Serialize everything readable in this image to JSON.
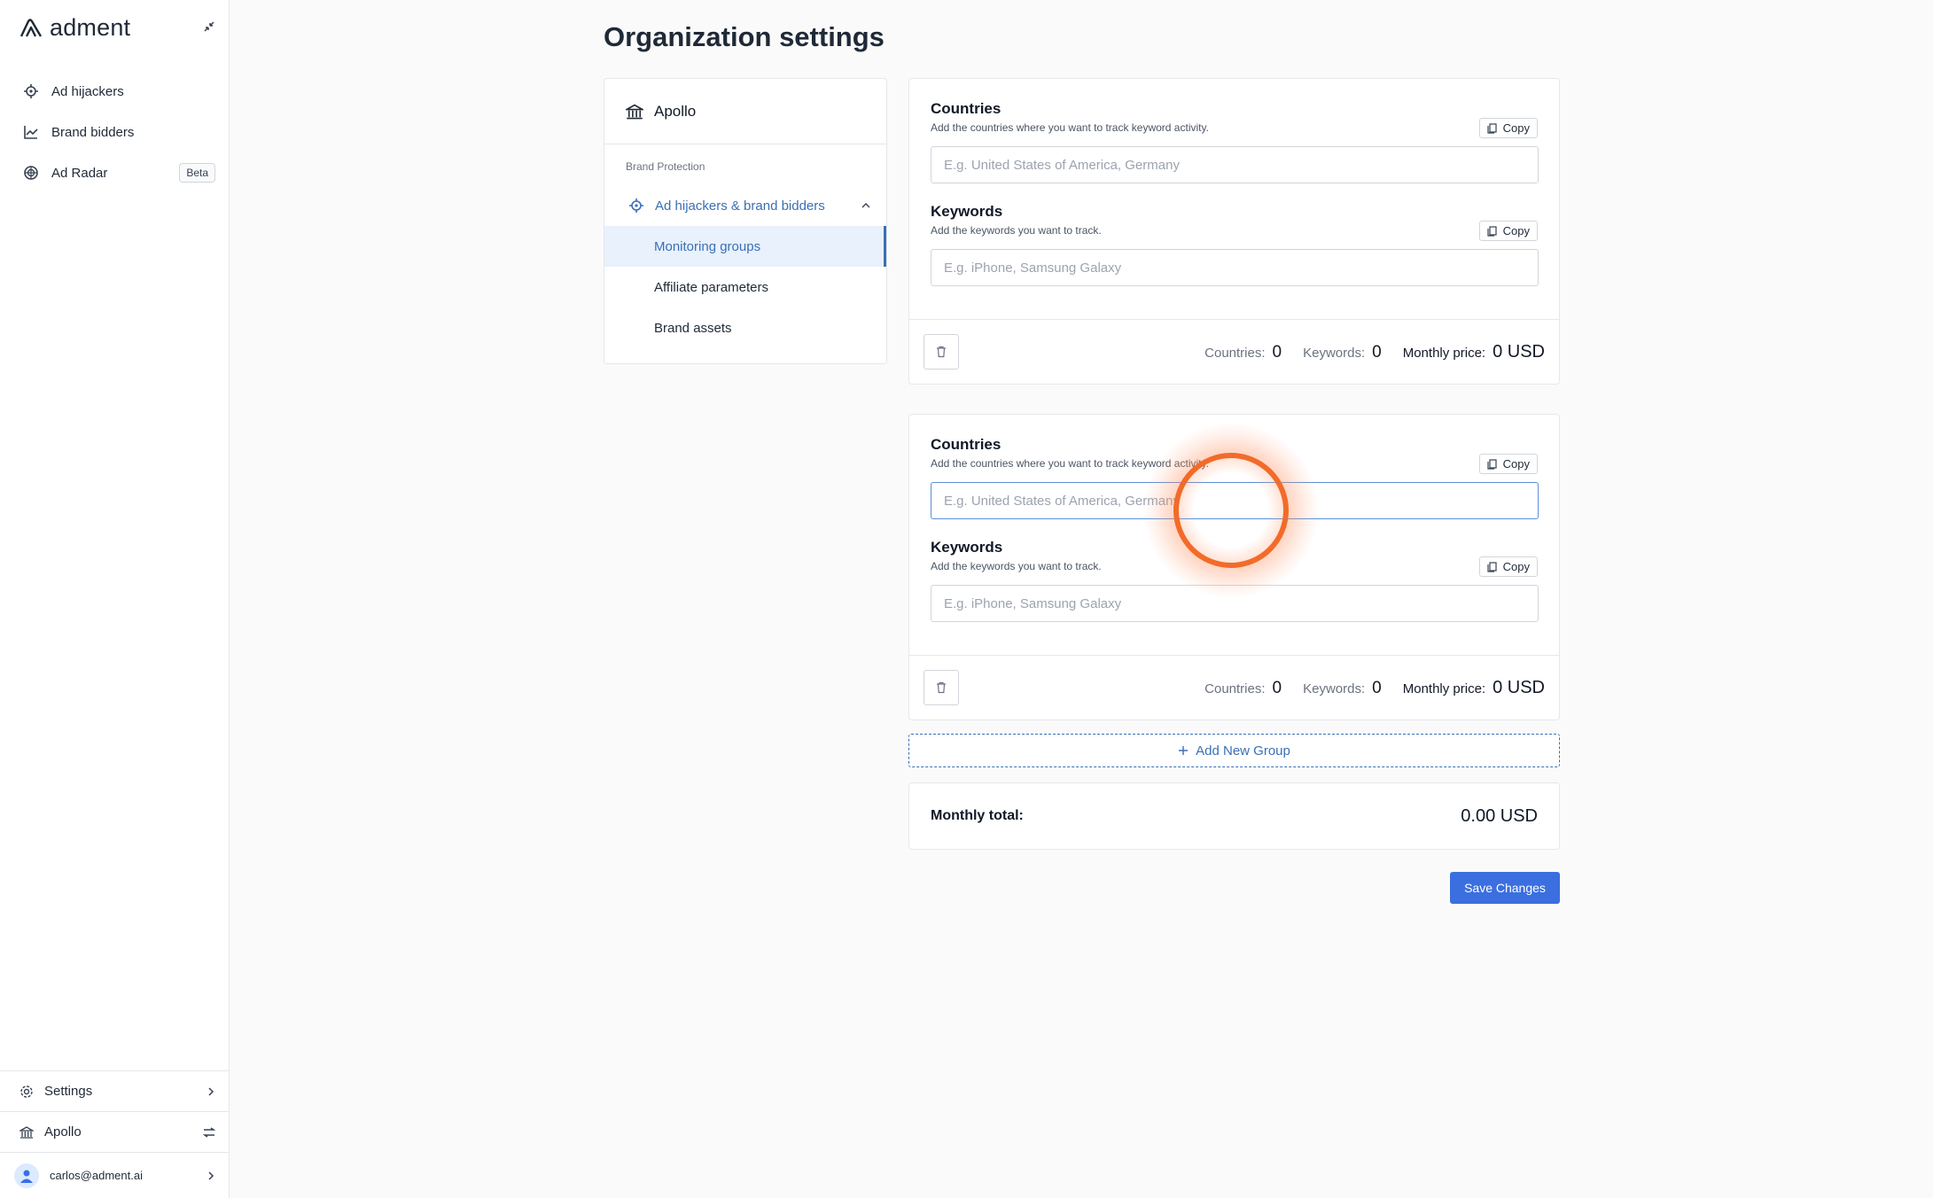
{
  "app": {
    "name": "adment"
  },
  "sidebar": {
    "items": [
      {
        "label": "Ad hijackers",
        "icon": "crosshair-icon"
      },
      {
        "label": "Brand bidders",
        "icon": "line-chart-icon"
      },
      {
        "label": "Ad Radar",
        "icon": "radar-icon",
        "badge": "Beta"
      }
    ],
    "settings_label": "Settings",
    "org_label": "Apollo",
    "user_email": "carlos@adment.ai"
  },
  "page": {
    "title": "Organization settings"
  },
  "org_panel": {
    "org_name": "Apollo",
    "section_label": "Brand Protection",
    "parent_item": "Ad hijackers & brand bidders",
    "sub_items": [
      "Monitoring groups",
      "Affiliate parameters",
      "Brand assets"
    ],
    "active_item": "Monitoring groups"
  },
  "groups": [
    {
      "countries_title": "Countries",
      "countries_desc": "Add the countries where you want to track keyword activity.",
      "countries_placeholder": "E.g. United States of America, Germany",
      "keywords_title": "Keywords",
      "keywords_desc": "Add the keywords you want to track.",
      "keywords_placeholder": "E.g. iPhone, Samsung Galaxy",
      "copy_label": "Copy",
      "countries_count_label": "Countries:",
      "countries_count": "0",
      "keywords_count_label": "Keywords:",
      "keywords_count": "0",
      "price_label": "Monthly price:",
      "price": "0 USD"
    },
    {
      "countries_title": "Countries",
      "countries_desc": "Add the countries where you want to track keyword activity.",
      "countries_placeholder": "E.g. United States of America, Germany",
      "keywords_title": "Keywords",
      "keywords_desc": "Add the keywords you want to track.",
      "keywords_placeholder": "E.g. iPhone, Samsung Galaxy",
      "copy_label": "Copy",
      "countries_count_label": "Countries:",
      "countries_count": "0",
      "keywords_count_label": "Keywords:",
      "keywords_count": "0",
      "price_label": "Monthly price:",
      "price": "0 USD"
    }
  ],
  "add_group_label": "Add New Group",
  "total": {
    "label": "Monthly total:",
    "value": "0.00 USD"
  },
  "save_label": "Save Changes",
  "colors": {
    "accent": "#3b6fb6",
    "primary_button": "#3b6fe0",
    "active_bg": "#e8f1fc",
    "click_indicator": "#f26b2a"
  }
}
